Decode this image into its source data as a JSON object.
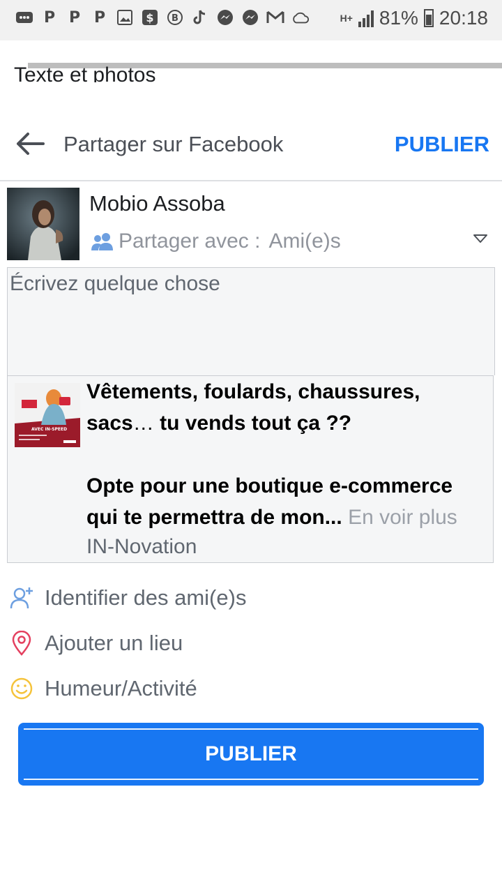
{
  "status_bar": {
    "icons": [
      "notification-icon",
      "p-icon",
      "p-icon",
      "p-icon",
      "image-icon",
      "dollar-icon",
      "b-icon",
      "tiktok-icon",
      "messenger-icon",
      "messenger-icon",
      "gmail-icon",
      "cloud-icon"
    ],
    "network": "H+",
    "battery": "81%",
    "time": "20:18"
  },
  "background_title": "Texte et photos",
  "header": {
    "title": "Partager sur Facebook",
    "publish_label": "PUBLIER"
  },
  "profile": {
    "name": "Mobio Assoba",
    "share_with_label": "Partager avec :",
    "share_with_value": "Ami(e)s"
  },
  "composer": {
    "placeholder": "Écrivez quelque chose"
  },
  "link_preview": {
    "line1": "Vêtements, foulards, chaussures,",
    "line2_a": "sacs",
    "line2_ellipsis": "…",
    "line2_b": " tu vends tout ça ??",
    "line3": "Opte pour une boutique e-commerce",
    "line4": "qui te permettra de mon...",
    "see_more": " En voir plus",
    "source": "IN-Novation",
    "thumb_text": "AVEC IN-SPEED"
  },
  "actions": [
    {
      "label": "Identifier des ami(e)s",
      "icon": "tag-friends-icon"
    },
    {
      "label": "Ajouter un lieu",
      "icon": "location-pin-icon"
    },
    {
      "label": "Humeur/Activité",
      "icon": "smiley-icon"
    }
  ],
  "publish_button": {
    "label": "PUBLIER"
  },
  "colors": {
    "accent": "#1877f2",
    "location": "#e4405f",
    "mood": "#f5c33b",
    "muted_text": "#606770"
  }
}
